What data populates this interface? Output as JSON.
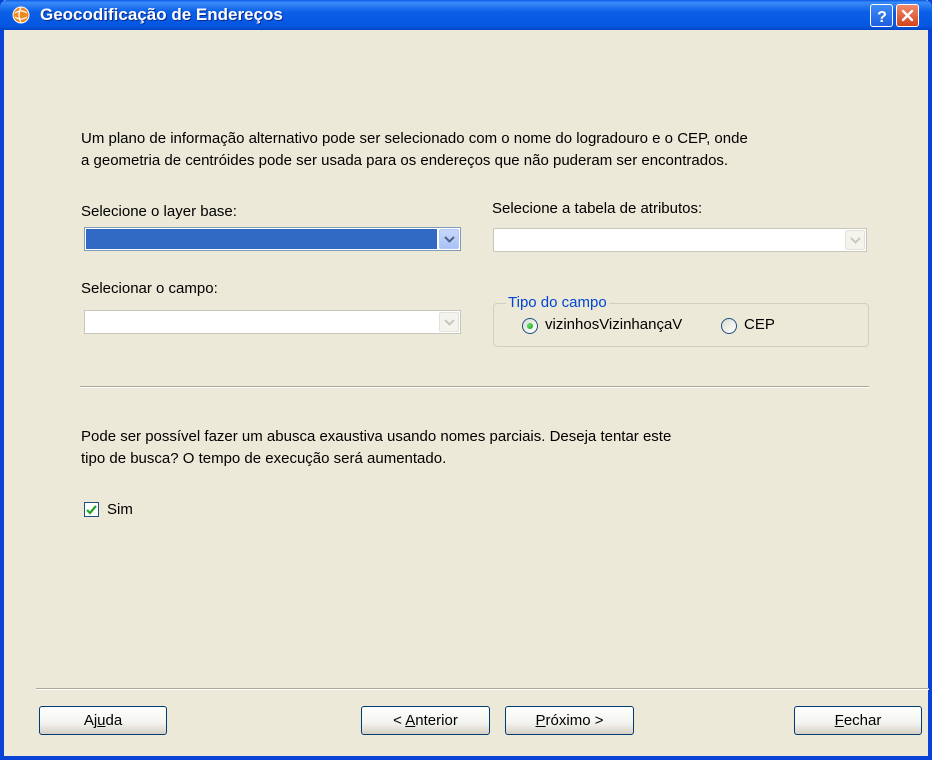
{
  "window": {
    "title": "Geocodificação de Endereços",
    "app_icon": "geocoding-globe-icon",
    "colors": {
      "titlebar": "#0456e0",
      "close": "#d2431c",
      "selection": "#316ac5",
      "groupbox_title": "#0046d5"
    }
  },
  "intro": {
    "line1": "Um plano de informação alternativo pode ser selecionado com o nome do logradouro e o CEP, onde",
    "line2": "a geometria de centróides pode ser usada para os endereços que não puderam ser encontrados."
  },
  "layer_base": {
    "label": "Selecione o layer base:",
    "value": ""
  },
  "attribute_table": {
    "label": "Selecione a tabela de atributos:",
    "value": ""
  },
  "field": {
    "label": "Selecionar o campo:",
    "value": ""
  },
  "field_type": {
    "title": "Tipo do campo",
    "options": [
      {
        "label": "vizinhosVizinhançaV",
        "selected": true
      },
      {
        "label": "CEP",
        "selected": false
      }
    ]
  },
  "search": {
    "line1": "Pode ser possível fazer um abusca exaustiva usando nomes parciais. Deseja tentar este",
    "line2": "tipo de busca? O tempo de execução será aumentado.",
    "checkbox_label": "Sim",
    "checked": true
  },
  "buttons": {
    "help": {
      "before": "Aj",
      "mnemonic": "u",
      "after": "da"
    },
    "previous": {
      "before": "< ",
      "mnemonic": "A",
      "after": "nterior"
    },
    "next": {
      "before": "",
      "mnemonic": "P",
      "after": "róximo >"
    },
    "close": {
      "before": "",
      "mnemonic": "F",
      "after": "echar"
    }
  }
}
